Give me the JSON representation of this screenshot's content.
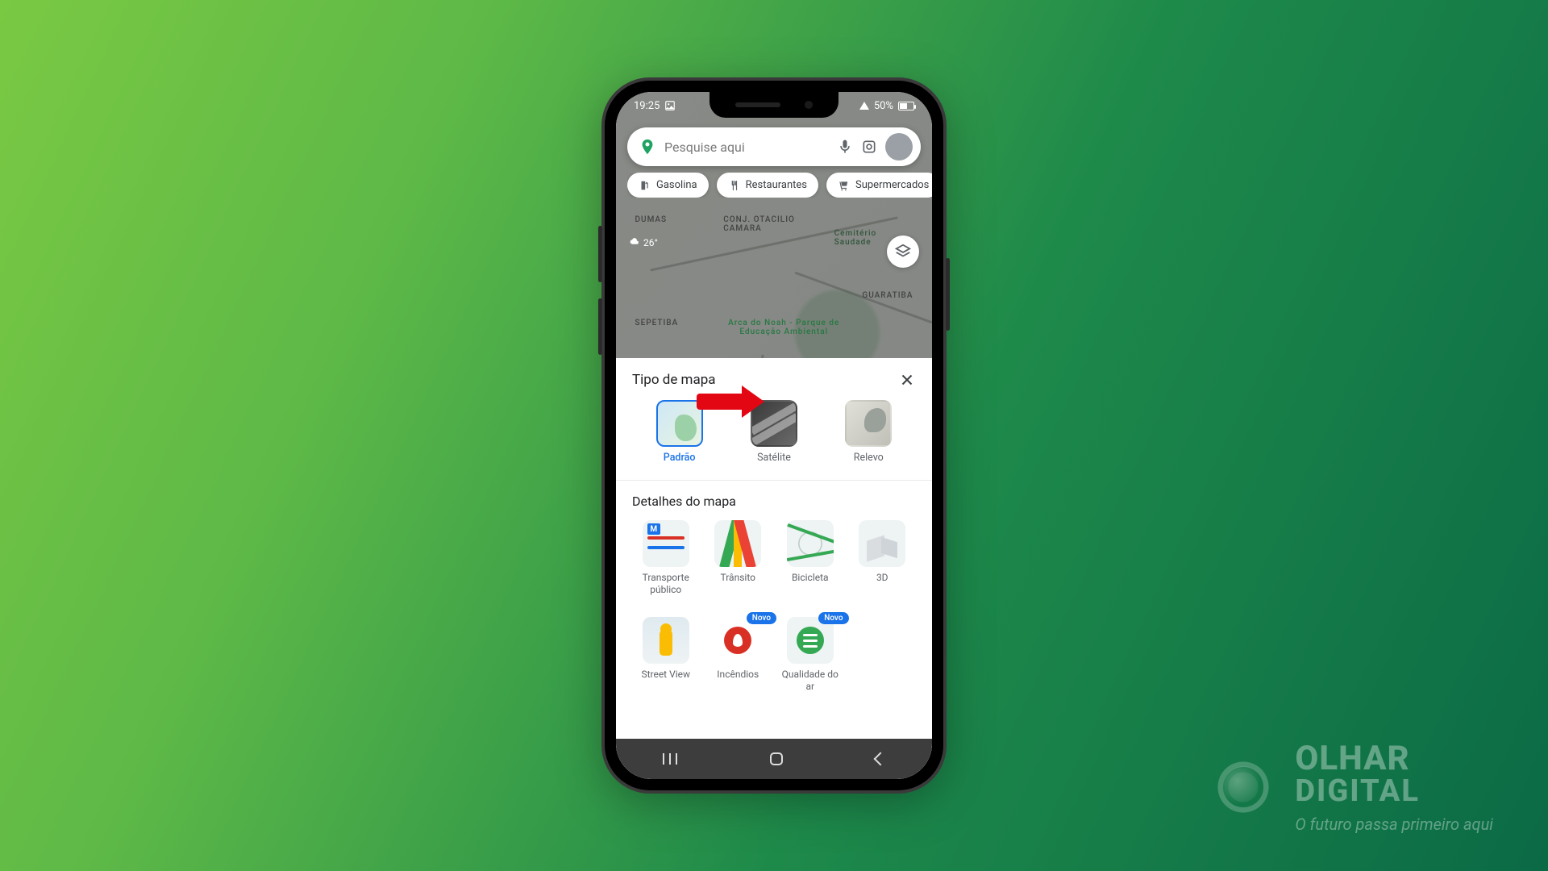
{
  "status": {
    "time": "19:25",
    "battery_pct": "50%"
  },
  "search": {
    "placeholder": "Pesquise aqui"
  },
  "chips": [
    {
      "icon": "fuel-icon",
      "label": "Gasolina"
    },
    {
      "icon": "restaurant-icon",
      "label": "Restaurantes"
    },
    {
      "icon": "cart-icon",
      "label": "Supermercados"
    }
  ],
  "weather": {
    "temp": "26°"
  },
  "map_labels": {
    "sepetiba": "SEPETIBA",
    "guaratiba": "GUARATIBA",
    "dumas": "DUMAS",
    "camara": "CONJ. OTACILIO CAMARA",
    "cemiterio": "Cemitério Saudade",
    "arca": "Arca do Noah - Parque de Educação Ambiental"
  },
  "sheet": {
    "title_type": "Tipo de mapa",
    "types": [
      {
        "key": "default",
        "label": "Padrão",
        "selected": true
      },
      {
        "key": "satellite",
        "label": "Satélite",
        "selected": false
      },
      {
        "key": "terrain",
        "label": "Relevo",
        "selected": false
      }
    ],
    "title_details": "Detalhes do mapa",
    "details": [
      {
        "key": "transit",
        "label": "Transporte público"
      },
      {
        "key": "traffic",
        "label": "Trânsito"
      },
      {
        "key": "bike",
        "label": "Bicicleta"
      },
      {
        "key": "3d",
        "label": "3D"
      },
      {
        "key": "streetview",
        "label": "Street View"
      },
      {
        "key": "fires",
        "label": "Incêndios",
        "badge": "Novo"
      },
      {
        "key": "air",
        "label": "Qualidade do ar",
        "badge": "Novo"
      }
    ]
  },
  "watermark": {
    "line1": "OLHAR",
    "line2": "DIGITAL",
    "tagline": "O futuro passa primeiro aqui"
  }
}
